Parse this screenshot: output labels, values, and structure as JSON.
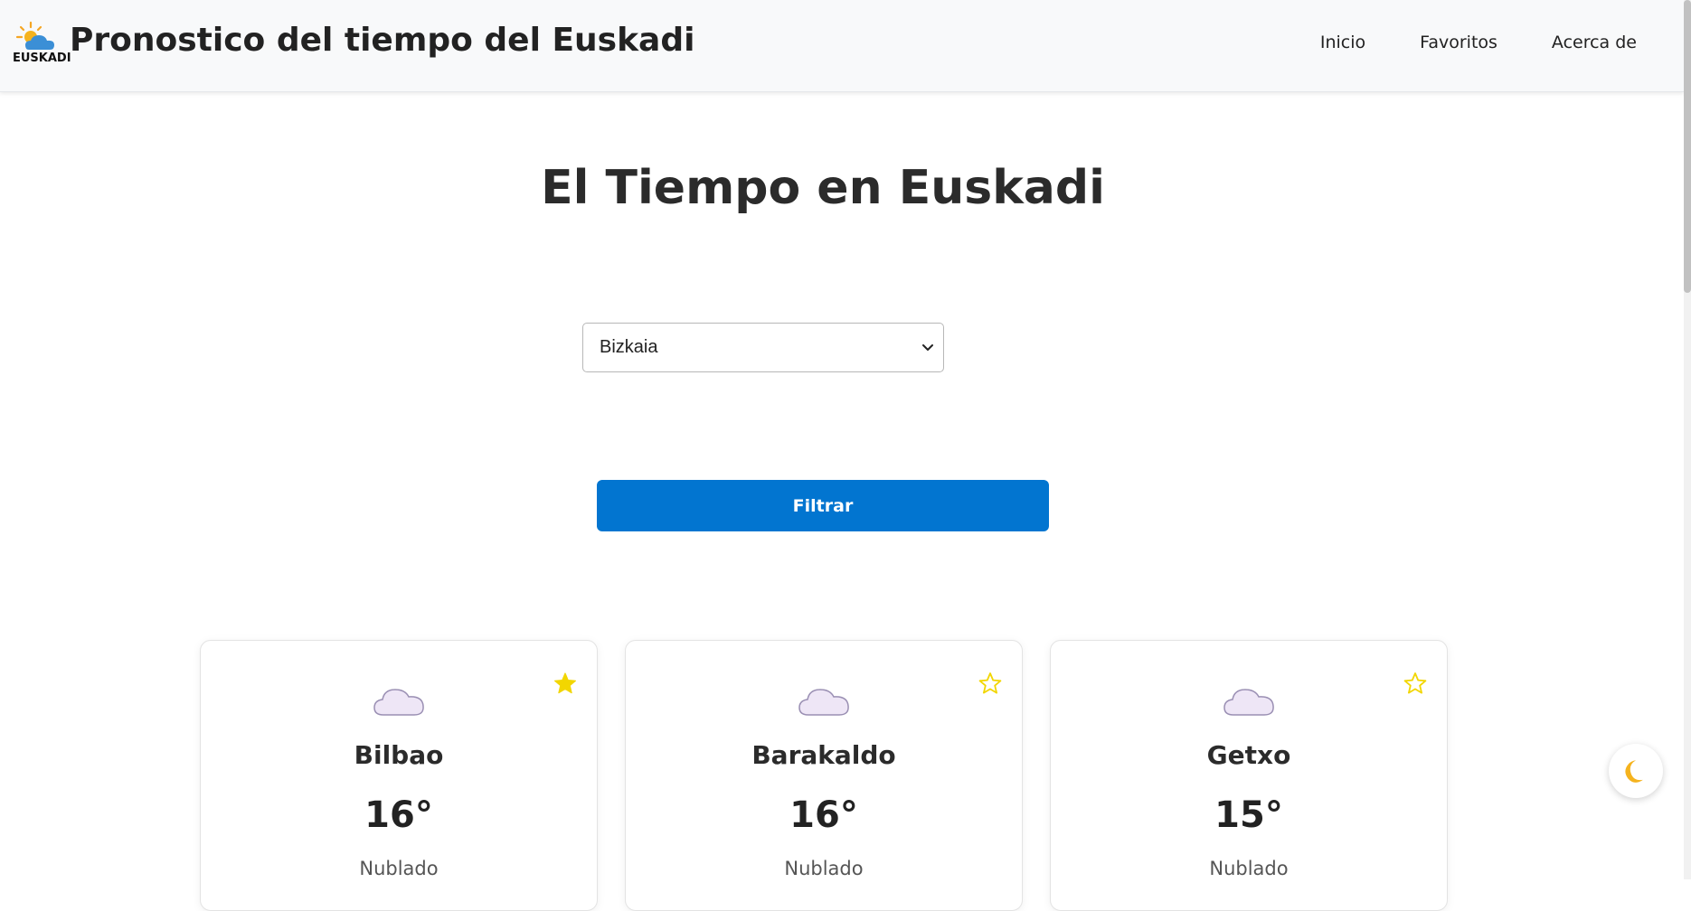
{
  "header": {
    "logo_text": "EUSKADI",
    "title": "Pronostico del tiempo del Euskadi",
    "nav": [
      {
        "label": "Inicio"
      },
      {
        "label": "Favoritos"
      },
      {
        "label": "Acerca de"
      }
    ]
  },
  "main": {
    "heading": "El Tiempo en Euskadi",
    "province_select": {
      "selected": "Bizkaia"
    },
    "filter_button": "Filtrar"
  },
  "cards": [
    {
      "city": "Bilbao",
      "temp": "16°",
      "desc": "Nublado",
      "favorite": true,
      "icon": "cloud-icon"
    },
    {
      "city": "Barakaldo",
      "temp": "16°",
      "desc": "Nublado",
      "favorite": false,
      "icon": "cloud-icon"
    },
    {
      "city": "Getxo",
      "temp": "15°",
      "desc": "Nublado",
      "favorite": false,
      "icon": "cloud-icon"
    }
  ],
  "theme_toggle": {
    "icon": "moon-icon"
  },
  "colors": {
    "accent": "#0275d0",
    "star": "#f2d600",
    "cloud_fill": "#eee6f6",
    "cloud_stroke": "#9a8fb3",
    "navbar_bg": "#f8f9fa"
  }
}
